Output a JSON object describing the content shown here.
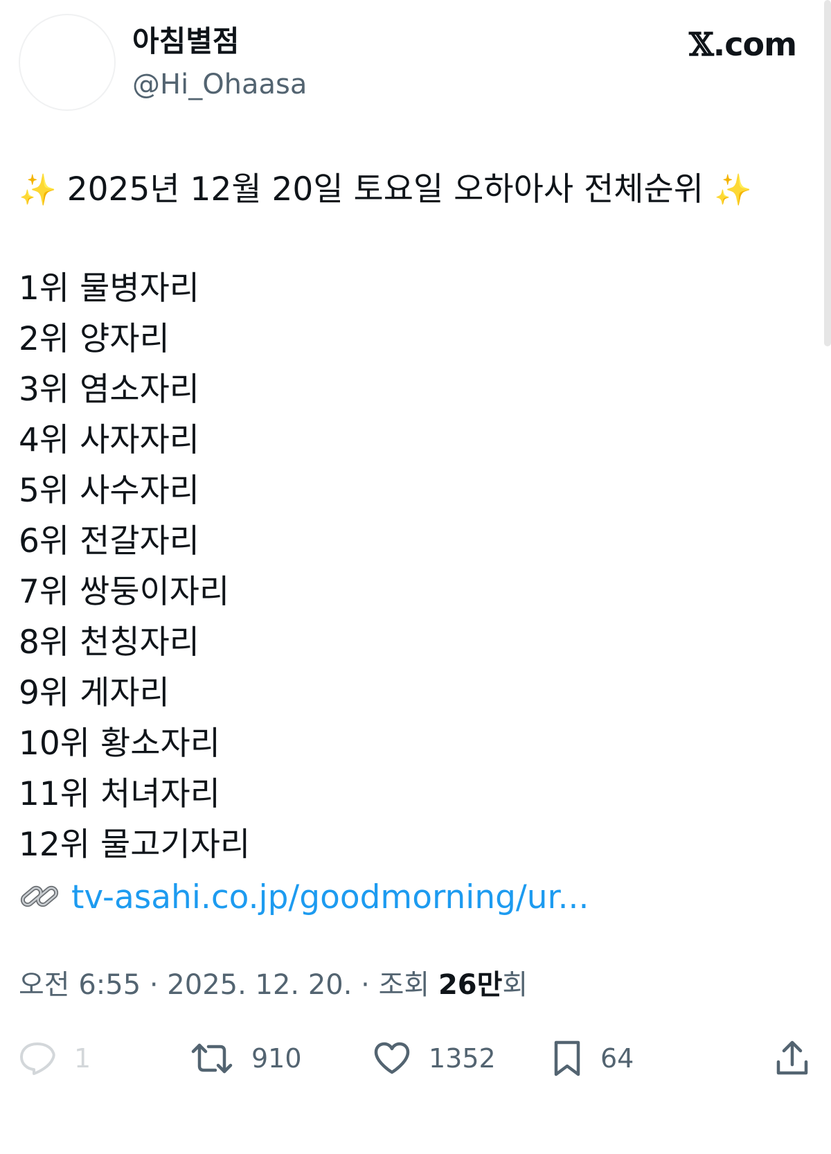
{
  "author": {
    "display_name": "아침별점",
    "handle": "@Hi_Ohaasa"
  },
  "brand": {
    "watermark_x": "𝕏",
    "watermark_rest": ".com"
  },
  "tweet": {
    "sparkle_left": "✨",
    "headline": "2025년 12월 20일 토요일 오하아사 전체순위",
    "sparkle_right": "✨",
    "rankings": [
      "1위 물병자리",
      "2위 양자리",
      "3위 염소자리",
      "4위 사자자리",
      "5위 사수자리",
      "6위 전갈자리",
      "7위 쌍둥이자리",
      "8위 천칭자리",
      "9위 게자리",
      "10위 황소자리",
      "11위 처녀자리",
      "12위 물고기자리"
    ],
    "link_text": "tv-asahi.co.jp/goodmorning/ur..."
  },
  "meta": {
    "time": "오전 6:55",
    "separator": " · ",
    "date": "2025. 12. 20.",
    "views_label": "조회",
    "views_count": "26만",
    "views_suffix": "회"
  },
  "actions": {
    "reply_count": "1",
    "retweet_count": "910",
    "like_count": "1352",
    "bookmark_count": "64"
  },
  "colors": {
    "link": "#1d9bf0",
    "muted": "#536471",
    "text": "#0f1419"
  },
  "icons": [
    "reply-icon",
    "retweet-icon",
    "like-icon",
    "bookmark-icon",
    "share-icon",
    "link-icon"
  ]
}
